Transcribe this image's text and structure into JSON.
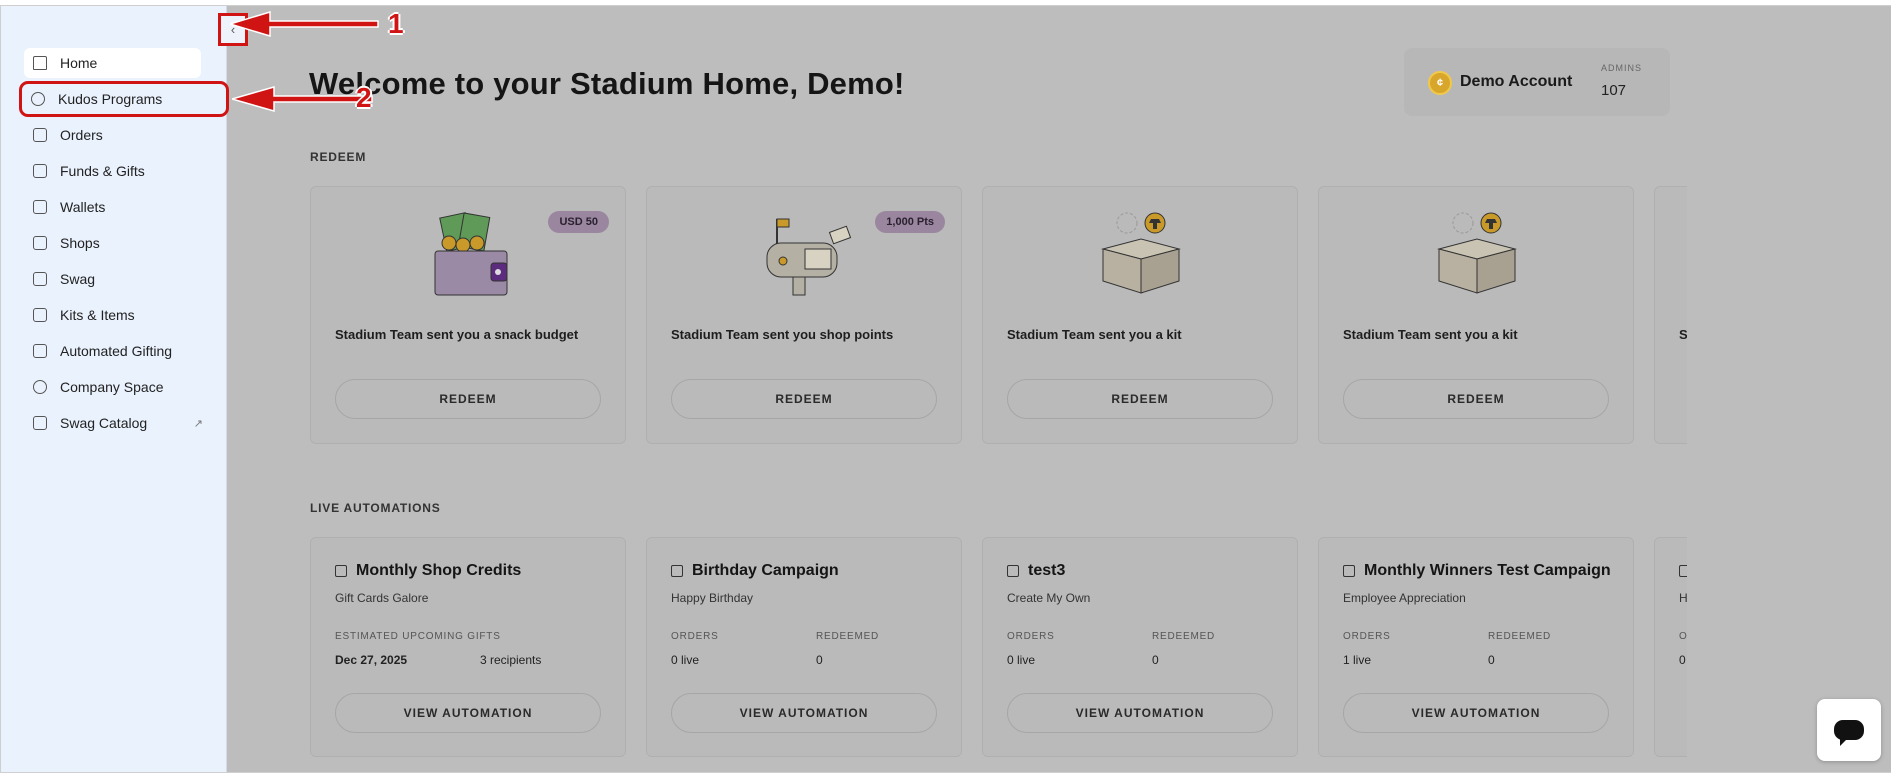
{
  "sidebar": {
    "collapse_label": "‹",
    "items": [
      {
        "label": "Home",
        "icon": "home-icon"
      },
      {
        "label": "Kudos Programs",
        "icon": "award-icon"
      },
      {
        "label": "Orders",
        "icon": "bag-icon"
      },
      {
        "label": "Funds & Gifts",
        "icon": "gift-icon"
      },
      {
        "label": "Wallets",
        "icon": "wallet-icon"
      },
      {
        "label": "Shops",
        "icon": "store-icon"
      },
      {
        "label": "Swag",
        "icon": "shirt-icon"
      },
      {
        "label": "Kits & Items",
        "icon": "box-icon"
      },
      {
        "label": "Automated Gifting",
        "icon": "calendar-icon"
      },
      {
        "label": "Company Space",
        "icon": "globe-icon"
      },
      {
        "label": "Swag Catalog",
        "icon": "catalog-icon",
        "external": "↗"
      }
    ]
  },
  "header": {
    "title": "Welcome to your Stadium Home, Demo!",
    "account": {
      "name": "Demo Account",
      "admins_label": "ADMINS",
      "admins_value": "107"
    }
  },
  "redeem": {
    "section_label": "REDEEM",
    "cards": [
      {
        "badge": "USD 50",
        "text": "Stadium Team sent you a snack budget",
        "button": "REDEEM",
        "illustration": "wallet-money-illustration"
      },
      {
        "badge": "1,000 Pts",
        "text": "Stadium Team sent you shop points",
        "button": "REDEEM",
        "illustration": "mailbox-illustration"
      },
      {
        "badge": "",
        "text": "Stadium Team sent you a kit",
        "button": "REDEEM",
        "illustration": "box-illustration"
      },
      {
        "badge": "",
        "text": "Stadium Team sent you a kit",
        "button": "REDEEM",
        "illustration": "box-illustration"
      },
      {
        "badge": "",
        "text": "S",
        "button": "",
        "illustration": ""
      }
    ]
  },
  "automations": {
    "section_label": "LIVE AUTOMATIONS",
    "cards": [
      {
        "title": "Monthly Shop Credits",
        "subtitle": "Gift Cards Galore",
        "label1": "ESTIMATED UPCOMING GIFTS",
        "value1": "Dec 27, 2025",
        "label2": "",
        "value2": "3 recipients",
        "button": "VIEW AUTOMATION"
      },
      {
        "title": "Birthday Campaign",
        "subtitle": "Happy Birthday",
        "label1": "ORDERS",
        "value1": "0 live",
        "label2": "REDEEMED",
        "value2": "0",
        "button": "VIEW AUTOMATION"
      },
      {
        "title": "test3",
        "subtitle": "Create My Own",
        "label1": "ORDERS",
        "value1": "0 live",
        "label2": "REDEEMED",
        "value2": "0",
        "button": "VIEW AUTOMATION"
      },
      {
        "title": "Monthly Winners Test Campaign",
        "subtitle": "Employee Appreciation",
        "label1": "ORDERS",
        "value1": "1 live",
        "label2": "REDEEMED",
        "value2": "0",
        "button": "VIEW AUTOMATION"
      },
      {
        "title": "",
        "subtitle": "H",
        "label1": "O",
        "value1": "0",
        "label2": "",
        "value2": "",
        "button": ""
      }
    ]
  },
  "annotations": {
    "marker1": "1",
    "marker2": "2",
    "color": "#d01414"
  }
}
